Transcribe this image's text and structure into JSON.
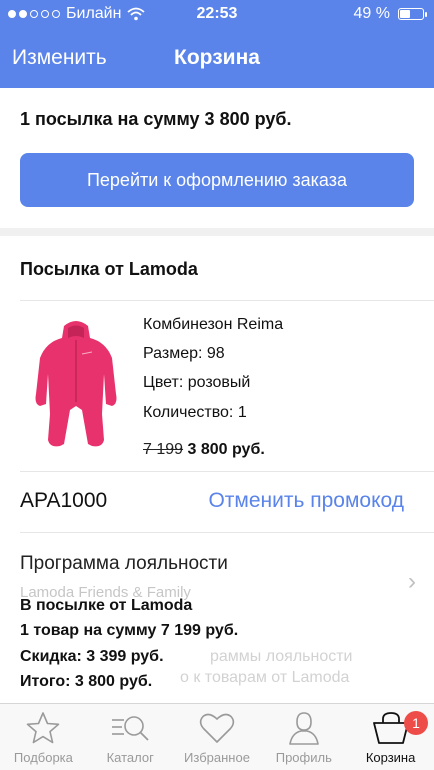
{
  "status_bar": {
    "carrier": "Билайн",
    "time": "22:53",
    "battery": "49 %",
    "signal_bars_filled": 2,
    "signal_bars_total": 5,
    "battery_level": 0.49
  },
  "nav": {
    "edit_label": "Изменить",
    "title": "Корзина"
  },
  "summary": {
    "text": "1 посылка на сумму 3 800 руб.",
    "checkout_label": "Перейти к оформлению заказа"
  },
  "parcel": {
    "title": "Посылка от Lamoda",
    "item": {
      "name": "Комбинезон Reima",
      "size": "Размер: 98",
      "color": "Цвет: розовый",
      "quantity": "Количество: 1",
      "old_price": "7 199",
      "price": "3 800 руб."
    }
  },
  "promo": {
    "code": "APA1000",
    "cancel_label": "Отменить промокод"
  },
  "loyalty": {
    "title": "Программа лояльности",
    "subtitle": "Lamoda Friends & Family",
    "faded_line1": "раммы лояльности",
    "faded_line2": "о к товарам от Lamoda"
  },
  "totals": {
    "header": "В посылке от Lamoda",
    "goods": "1 товар на сумму 7 199 руб.",
    "discount": "Скидка: 3 399 руб.",
    "total": "Итого: 3 800 руб."
  },
  "tabs": [
    {
      "label": "Подборка",
      "icon": "star-icon"
    },
    {
      "label": "Каталог",
      "icon": "catalog-search-icon"
    },
    {
      "label": "Избранное",
      "icon": "heart-icon"
    },
    {
      "label": "Профиль",
      "icon": "profile-icon"
    },
    {
      "label": "Корзина",
      "icon": "basket-icon",
      "badge": "1",
      "active": true
    }
  ],
  "colors": {
    "accent": "#5a84e9",
    "badge": "#ee4c48",
    "product": "#e8326d"
  }
}
